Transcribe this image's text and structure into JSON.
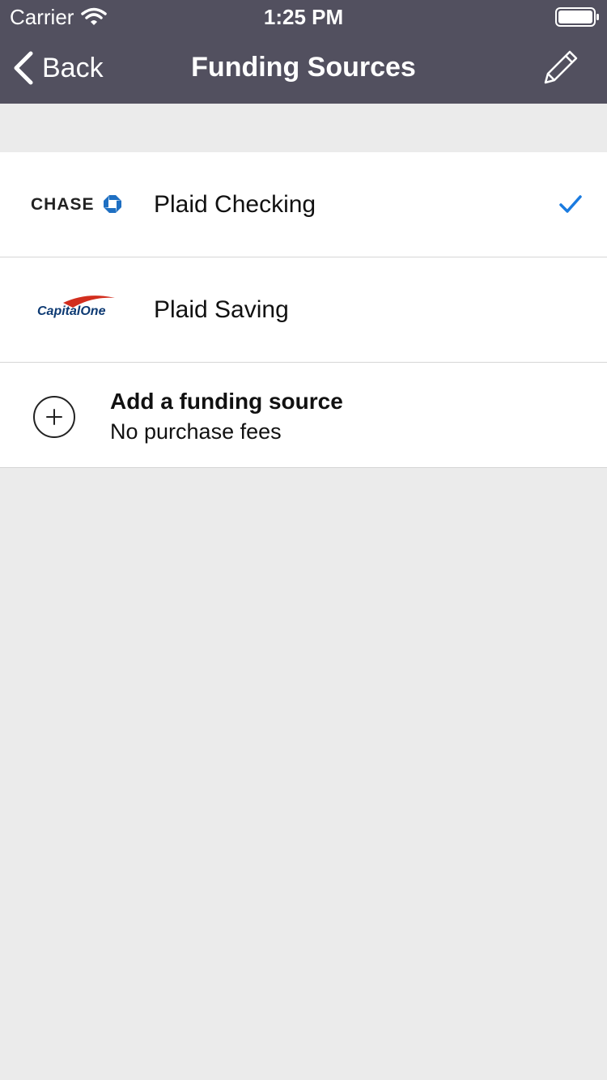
{
  "status": {
    "carrier": "Carrier",
    "time": "1:25 PM"
  },
  "nav": {
    "back_label": "Back",
    "title": "Funding Sources"
  },
  "sources": [
    {
      "name": "Plaid Checking",
      "bank_logo_text": "CHASE",
      "selected": true
    },
    {
      "name": "Plaid Saving",
      "bank_logo_text": "CapitalOne",
      "selected": false
    }
  ],
  "add_source": {
    "title": "Add a funding source",
    "subtitle": "No purchase fees"
  },
  "colors": {
    "nav_bg": "#52505f",
    "accent": "#1a7be0",
    "chase_blue": "#1e6fc2",
    "capitalone_navy": "#0d3a73",
    "capitalone_red": "#d22e1e"
  }
}
